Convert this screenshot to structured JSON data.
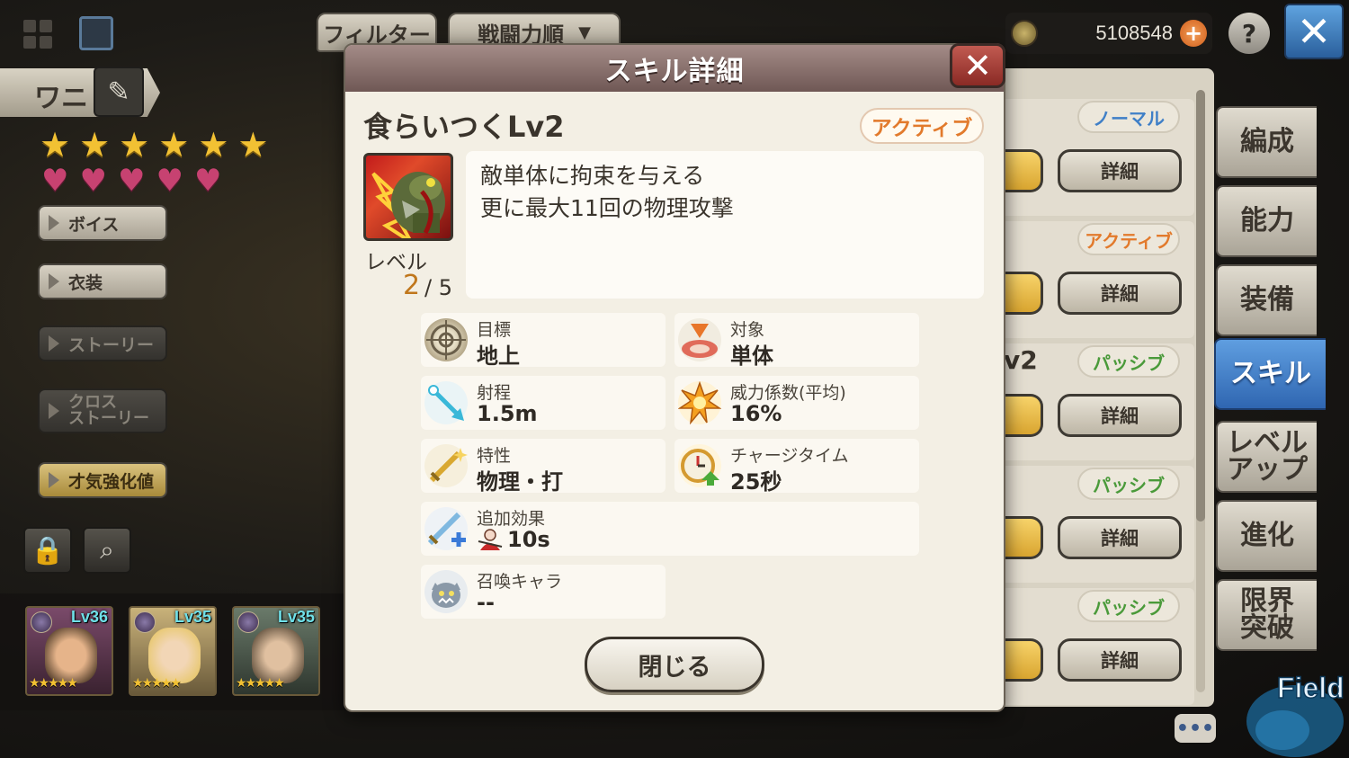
{
  "top_bar": {
    "filter_label": "フィルター",
    "sort_label": "戦闘力順",
    "coins": "5108548",
    "coin_plus": "+",
    "help": "?",
    "close": "✕"
  },
  "character": {
    "name": "ワニ",
    "stars": 6,
    "hearts": 5
  },
  "left_menu": [
    {
      "label": "ボイス",
      "state": "normal"
    },
    {
      "label": "衣装",
      "state": "normal"
    },
    {
      "label": "ストーリー",
      "state": "disabled"
    },
    {
      "label": "クロス\nストーリー",
      "state": "disabled"
    },
    {
      "label": "才気強化値",
      "state": "gold"
    }
  ],
  "party": [
    {
      "level": "Lv36"
    },
    {
      "level": "Lv35"
    },
    {
      "level": "Lv35"
    }
  ],
  "skill_list": [
    {
      "tag": "ノーマル",
      "tag_color": "#3f7fc7",
      "detail": "詳細"
    },
    {
      "tag": "アクティブ",
      "tag_color": "#e27a2c",
      "detail": "詳細"
    },
    {
      "tag": "パッシブ",
      "tag_color": "#4a9a3a",
      "detail": "詳細",
      "peek": "v2"
    },
    {
      "tag": "パッシブ",
      "tag_color": "#4a9a3a",
      "detail": "詳細"
    },
    {
      "tag": "パッシブ",
      "tag_color": "#4a9a3a",
      "detail": "詳細"
    }
  ],
  "right_tabs": [
    {
      "label": "編成",
      "active": false
    },
    {
      "label": "能力",
      "active": false
    },
    {
      "label": "装備",
      "active": false
    },
    {
      "label": "スキル",
      "active": true
    },
    {
      "label": "レベル\nアップ",
      "active": false
    },
    {
      "label": "進化",
      "active": false
    },
    {
      "label": "限界\n突破",
      "active": false
    }
  ],
  "field_label": "Field",
  "chat": "•••",
  "modal": {
    "title": "スキル詳細",
    "close_x": "✕",
    "skill_name": "食らいつくLv2",
    "type_badge": "アクティブ",
    "level_label": "レベル",
    "level_current": "2",
    "level_max": "/ 5",
    "description": [
      "敵単体に拘束を与える",
      "更に最大11回の物理攻撃"
    ],
    "stats": {
      "target_area": {
        "label": "目標",
        "value": "地上"
      },
      "target_type": {
        "label": "対象",
        "value": "単体"
      },
      "range": {
        "label": "射程",
        "value": "1.5m"
      },
      "power": {
        "label": "威力係数(平均)",
        "value": "16%"
      },
      "attribute": {
        "label": "特性",
        "value": "物理・打"
      },
      "charge": {
        "label": "チャージタイム",
        "value": "25秒"
      },
      "extra": {
        "label": "追加効果",
        "value": "10s"
      },
      "summon": {
        "label": "召喚キャラ",
        "value": "--"
      }
    },
    "close_button": "閉じる"
  }
}
